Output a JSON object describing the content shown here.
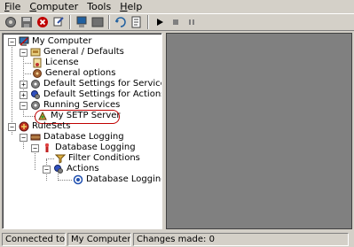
{
  "menu": {
    "items": [
      {
        "label": "File"
      },
      {
        "label": "Computer"
      },
      {
        "label": "Tools"
      },
      {
        "label": "Help"
      }
    ]
  },
  "toolbar": {
    "buttons": [
      {
        "icon": "gear-icon"
      },
      {
        "icon": "save-icon"
      },
      {
        "icon": "delete-icon"
      },
      {
        "icon": "tools-icon"
      },
      {
        "icon": "computer-icon"
      },
      {
        "icon": "window-icon"
      },
      {
        "icon": "refresh-icon"
      },
      {
        "icon": "properties-icon"
      },
      {
        "icon": "play-icon"
      },
      {
        "icon": "stop-icon"
      },
      {
        "icon": "pause-icon"
      }
    ]
  },
  "tree": {
    "items": [
      {
        "label": "My Computer",
        "icon": "computer-icon"
      },
      {
        "label": "General / Defaults",
        "icon": "general-icon"
      },
      {
        "label": "License",
        "icon": "license-icon"
      },
      {
        "label": "General options",
        "icon": "options-icon"
      },
      {
        "label": "Default Settings for Services",
        "icon": "services-icon"
      },
      {
        "label": "Default Settings for Actions",
        "icon": "actions-icon"
      },
      {
        "label": "Running Services",
        "icon": "services-icon"
      },
      {
        "label": "My SETP Server",
        "icon": "server-icon",
        "highlighted": true
      },
      {
        "label": "RuleSets",
        "icon": "rulesets-icon"
      },
      {
        "label": "Database Logging",
        "icon": "db-logging-icon"
      },
      {
        "label": "Database Logging",
        "icon": "rule-icon"
      },
      {
        "label": "Filter Conditions",
        "icon": "filter-icon"
      },
      {
        "label": "Actions",
        "icon": "actions-icon"
      },
      {
        "label": "Database Logging",
        "icon": "action-item-icon"
      }
    ]
  },
  "statusbar": {
    "connected_label": "Connected to:",
    "connected_value": "My Computer",
    "changes": "Changes made: 0"
  },
  "colors": {
    "highlight_ring": "#c00000",
    "right_panel": "#808080",
    "chrome": "#d4d0c8"
  }
}
